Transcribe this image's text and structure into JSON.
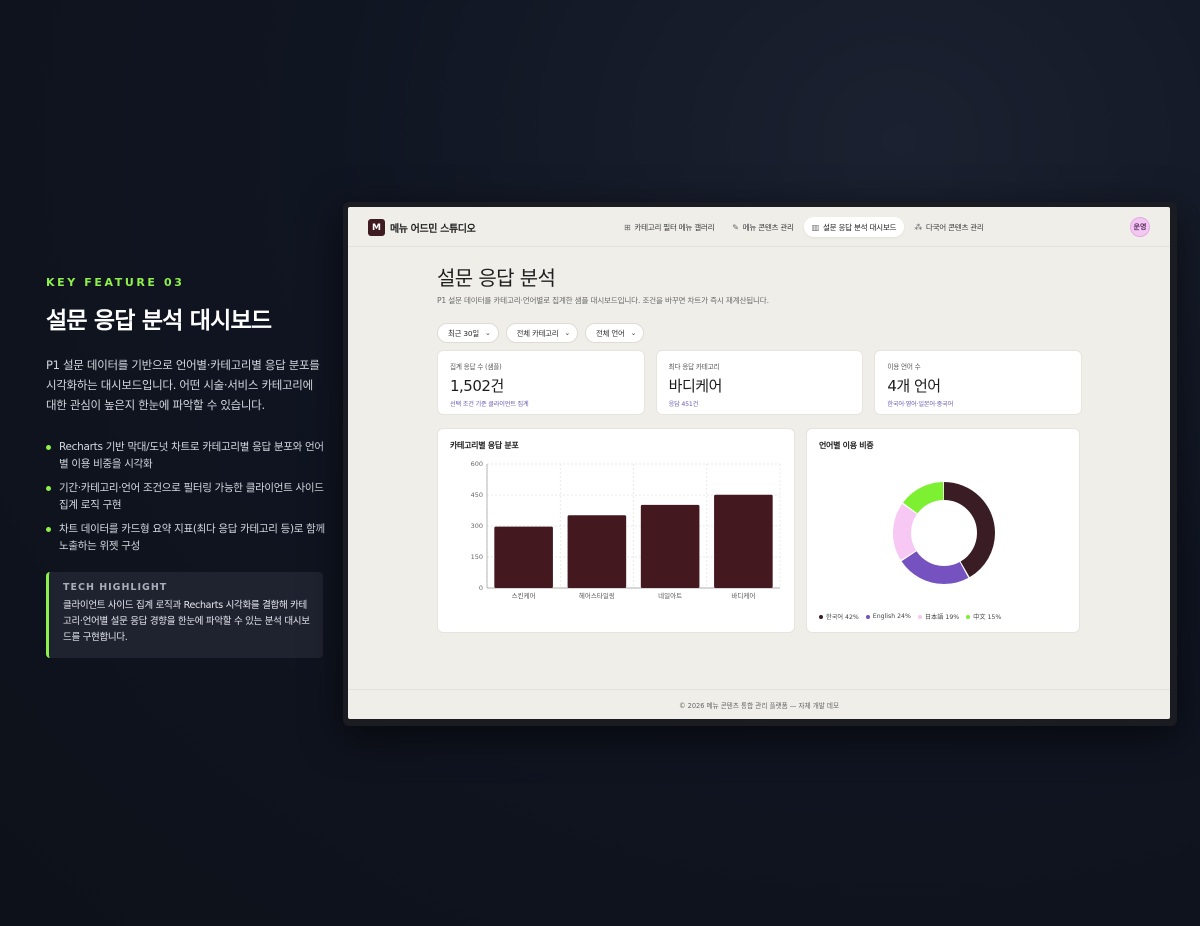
{
  "promo": {
    "label": "KEY FEATURE 03",
    "title": "설문 응답 분석 대시보드",
    "description": "P1 설문 데이터를 기반으로 언어별·카테고리별 응답 분포를 시각화하는 대시보드입니다. 어떤 시술·서비스 카테고리에 대한 관심이 높은지 한눈에 파악할 수 있습니다.",
    "bullets": [
      "Recharts 기반 막대/도넛 차트로 카테고리별 응답 분포와 언어별 이용 비중을 시각화",
      "기간·카테고리·언어 조건으로 필터링 가능한 클라이언트 사이드 집계 로직 구현",
      "차트 데이터를 카드형 요약 지표(최다 응답 카테고리 등)로 함께 노출하는 위젯 구성"
    ],
    "tech_label": "TECH HIGHLIGHT",
    "tech_body": "클라이언트 사이드 집계 로직과 Recharts 시각화를 결합해 카테고리·언어별 설문 응답 경향을 한눈에 파악할 수 있는 분석 대시보드를 구현합니다."
  },
  "app": {
    "brand_letter": "M",
    "brand_name": "메뉴 어드민 스튜디오",
    "nav": [
      {
        "icon": "⊞",
        "label": "카테고리 필터 메뉴 갤러리",
        "active": false
      },
      {
        "icon": "✎",
        "label": "메뉴 콘텐츠 관리",
        "active": false
      },
      {
        "icon": "▥",
        "label": "설문 응답 분석 대시보드",
        "active": true
      },
      {
        "icon": "⁂",
        "label": "다국어 콘텐츠 관리",
        "active": false
      }
    ],
    "avatar": "운영",
    "page_title": "설문 응답 분석",
    "page_subtitle": "P1 설문 데이터를 카테고리·언어별로 집계한 샘플 대시보드입니다. 조건을 바꾸면 차트가 즉시 재계산됩니다.",
    "filters": [
      "최근 30일",
      "전체 카테고리",
      "전체 언어"
    ],
    "kpis": [
      {
        "label": "집계 응답 수 (샘플)",
        "value": "1,502건",
        "note": "선택 조건 기준 클라이언트 집계"
      },
      {
        "label": "최다 응답 카테고리",
        "value": "바디케어",
        "note": "응답 451건"
      },
      {
        "label": "이용 언어 수",
        "value": "4개 언어",
        "note": "한국어·영어·일본어·중국어"
      }
    ],
    "bar_title": "카테고리별 응답 분포",
    "donut_title": "언어별 이용 비중",
    "footer": "© 2026 메뉴 콘텐츠 통합 관리 플랫폼 — 자체 개발 데모"
  },
  "chart_data": [
    {
      "type": "bar",
      "title": "카테고리별 응답 분포",
      "categories": [
        "스킨케어",
        "헤어스타일링",
        "네일아트",
        "바디케어"
      ],
      "values": [
        297,
        352,
        402,
        451
      ],
      "ylim": [
        0,
        600
      ],
      "yticks": [
        0,
        150,
        300,
        450,
        600
      ],
      "grid": true,
      "color": "#43191f"
    },
    {
      "type": "pie",
      "title": "언어별 이용 비중",
      "labels": [
        "한국어",
        "English",
        "日本語",
        "中文"
      ],
      "values": [
        42,
        24,
        19,
        15
      ],
      "legend": [
        "한국어 42%",
        "English 24%",
        "日本語 19%",
        "中文 15%"
      ],
      "colors": [
        "#3a1c24",
        "#7652c0",
        "#f8c8f4",
        "#7ef032"
      ],
      "legend_position": "bottom-left"
    }
  ]
}
